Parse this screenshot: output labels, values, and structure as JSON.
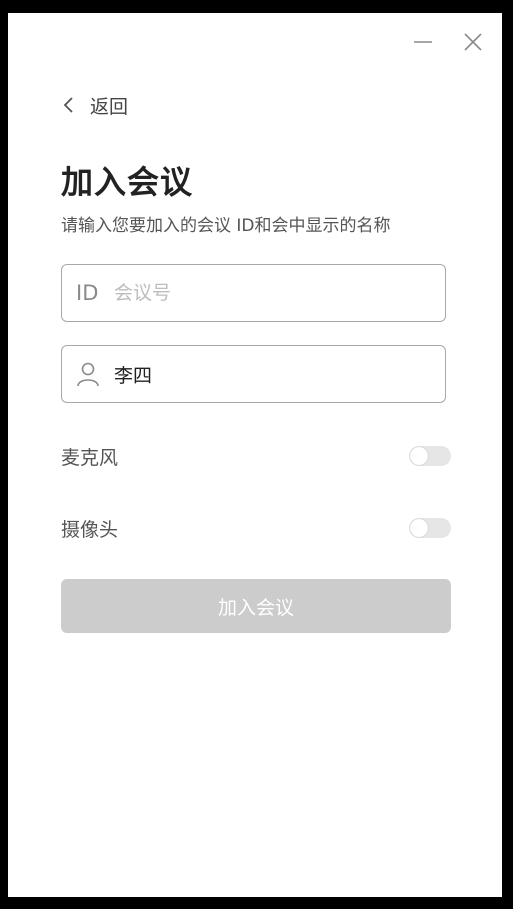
{
  "window": {
    "minimize_icon": "minimize-icon",
    "close_icon": "close-icon"
  },
  "nav": {
    "back_label": "返回",
    "back_icon": "chevron-left-icon"
  },
  "page": {
    "title": "加入会议",
    "subtitle": "请输入您要加入的会议 ID和会中显示的名称"
  },
  "form": {
    "meeting_id": {
      "prefix": "ID",
      "placeholder": "会议号",
      "value": ""
    },
    "display_name": {
      "icon": "user-icon",
      "value": "李四"
    },
    "microphone": {
      "label": "麦克风",
      "enabled": false
    },
    "camera": {
      "label": "摄像头",
      "enabled": false
    },
    "join_button_label": "加入会议"
  },
  "colors": {
    "button_disabled": "#cccccc",
    "toggle_off": "#e6e6e6",
    "field_border": "#a8a8a8"
  }
}
